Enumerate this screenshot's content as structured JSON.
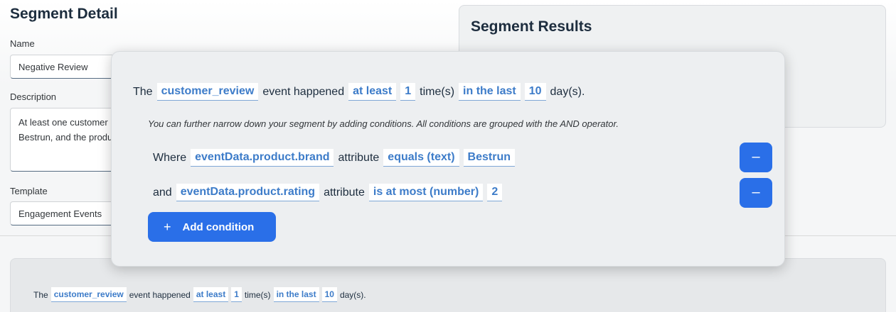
{
  "detail": {
    "title": "Segment Detail",
    "name_label": "Name",
    "name_value": "Negative Review",
    "description_label": "Description",
    "description_value": "At least one customer\nBestrun, and the produ",
    "template_label": "Template",
    "template_value": "Engagement Events"
  },
  "results": {
    "title": "Segment Results"
  },
  "modal": {
    "sentence": {
      "prefix": "The",
      "event": "customer_review",
      "text1": "event happened",
      "operator": "at least",
      "count": "1",
      "text2": "time(s)",
      "range": "in the last",
      "days": "10",
      "suffix": "day(s)."
    },
    "hint": "You can further narrow down your segment by adding conditions. All conditions are grouped with the AND operator.",
    "conditions": [
      {
        "connector": "Where",
        "attribute": "eventData.product.brand",
        "attr_word": "attribute",
        "operator": "equals (text)",
        "value": "Bestrun"
      },
      {
        "connector": "and",
        "attribute": "eventData.product.rating",
        "attr_word": "attribute",
        "operator": "is at most (number)",
        "value": "2"
      }
    ],
    "remove_label": "–",
    "add_condition_plus": "+",
    "add_condition_label": "Add condition"
  },
  "bottom": {
    "sentence": {
      "prefix": "The",
      "event": "customer_review",
      "text1": "event happened",
      "operator": "at least",
      "count": "1",
      "text2": "time(s)",
      "range": "in the last",
      "days": "10",
      "suffix": "day(s)."
    }
  },
  "colors": {
    "accent": "#2a6fe8",
    "token_text": "#3d7cc9"
  }
}
